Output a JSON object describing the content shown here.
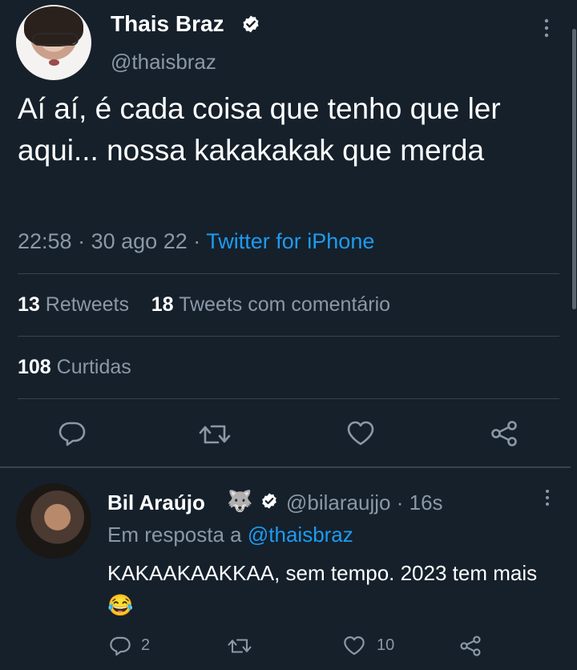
{
  "main_tweet": {
    "author_name": "Thais Braz",
    "author_handle": "@thaisbraz",
    "text": "Aí aí, é cada coisa que tenho que ler aqui... nossa kakakakak que merda",
    "time": "22:58",
    "separator": "·",
    "date": "30 ago 22",
    "source": "Twitter for iPhone",
    "retweets_count": "13",
    "retweets_label": "Retweets",
    "quotes_count": "18",
    "quotes_label": "Tweets com comentário",
    "likes_count": "108",
    "likes_label": "Curtidas",
    "icons": [
      "more-icon",
      "verified-badge-icon",
      "reply-icon",
      "retweet-icon",
      "like-icon",
      "share-icon"
    ]
  },
  "reply_tweet": {
    "author_name": "Bil Araújo",
    "author_emoji": "🐺",
    "author_handle": "@bilaraujjo",
    "separator": "·",
    "time_ago": "16s",
    "reply_prefix": "Em resposta a",
    "reply_to_handle": "@thaisbraz",
    "text": "KAKAAKAAKKAA, sem tempo. 2023 tem mais 😂",
    "reply_count": "2",
    "retweet_count": "",
    "like_count": "10"
  },
  "colors": {
    "background": "#15202b",
    "text": "#ffffff",
    "muted": "#8b98a5",
    "link": "#1d9bf0",
    "divider": "#38444d"
  }
}
